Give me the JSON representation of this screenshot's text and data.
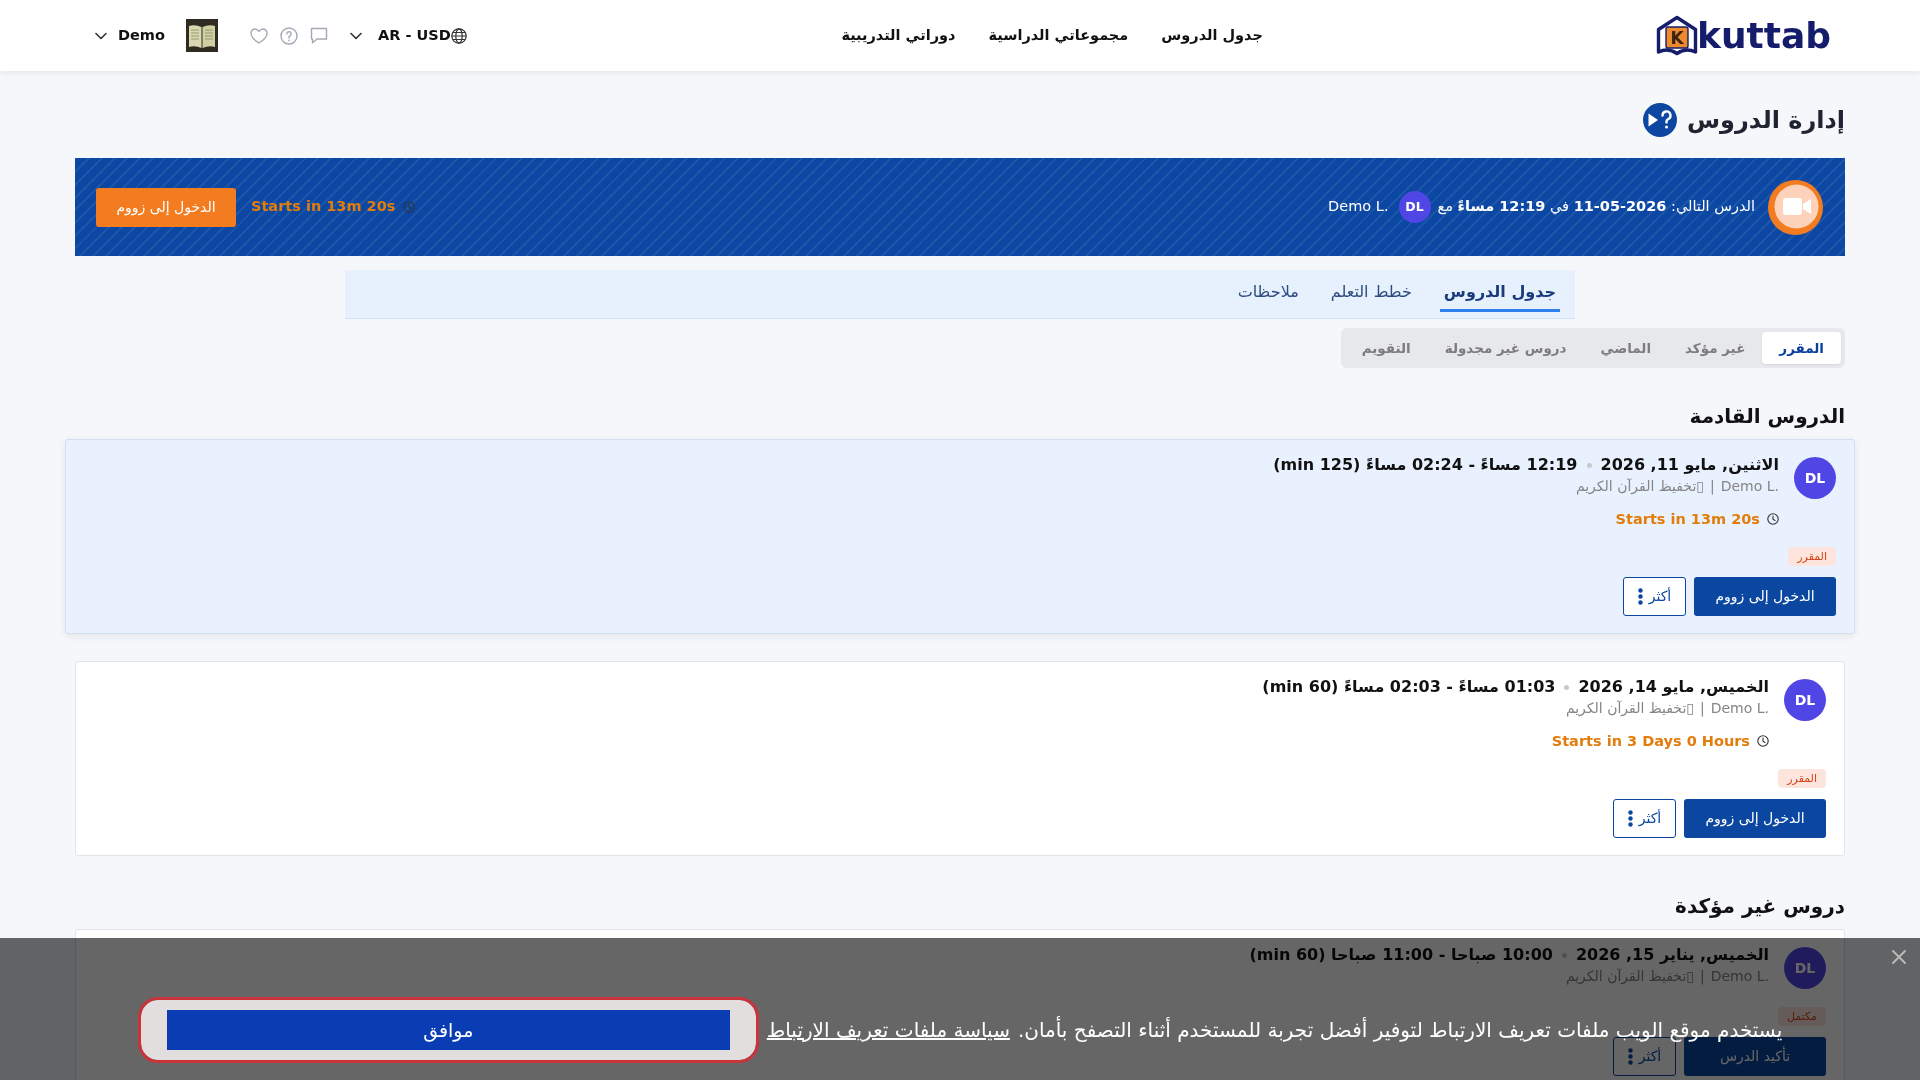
{
  "header": {
    "logo": {
      "letter": "K",
      "name": "kuttab"
    },
    "nav": [
      "جدول الدروس",
      "مجموعاتي الدراسية",
      "دوراتي التدريبية"
    ],
    "locale": "AR - USD",
    "user": "Demo"
  },
  "page_title": "إدارة الدروس",
  "next_lesson": {
    "text": "الدرس التالي: **11-05-2026** في **12:19 مساءً** مع",
    "avatar": "DL",
    "teacher": "Demo L.",
    "countdown": "Starts in 13m 20s",
    "action": "الدخول إلى زووم"
  },
  "tabs": [
    {
      "label": "جدول الدروس",
      "selected": true
    },
    {
      "label": "خطط التعلم",
      "selected": false
    },
    {
      "label": "ملاحظات",
      "selected": false
    }
  ],
  "filters": [
    {
      "label": "المقرر",
      "selected": true
    },
    {
      "label": "غير مؤكد",
      "selected": false
    },
    {
      "label": "الماضي",
      "selected": false
    },
    {
      "label": "دروس غير مجدولة",
      "selected": false
    },
    {
      "label": "التقويم",
      "selected": false
    }
  ],
  "sections": [
    {
      "title": "الدروس القادمة",
      "lessons": [
        {
          "highlighted": true,
          "avatar": "DL",
          "date": "الاثنين, مايو 11, 2026",
          "time": "12:19 مساءً - 02:24 مساءً (125 min)",
          "teacher": "Demo L.",
          "separator": "|",
          "course": "▯تخفيظ القرآن الكريم",
          "countdown": "Starts in 13m 20s",
          "status": "المقرر",
          "action": "الدخول إلى زووم",
          "more": "أكثر"
        },
        {
          "highlighted": false,
          "avatar": "DL",
          "date": "الخميس, مايو 14, 2026",
          "time": "01:03 مساءً - 02:03 مساءً (60 min)",
          "teacher": "Demo L.",
          "separator": "|",
          "course": "▯تخفيظ القرآن الكريم",
          "countdown": "Starts in 3 Days 0 Hours",
          "status": "المقرر",
          "action": "الدخول إلى زووم",
          "more": "أكثر"
        }
      ]
    },
    {
      "title": "دروس غير مؤكدة",
      "lessons": [
        {
          "highlighted": false,
          "avatar": "DL",
          "date": "الخميس, يناير 15, 2026",
          "time": "10:00 صباحا - 11:00 صباحا (60 min)",
          "teacher": "Demo L.",
          "separator": "|",
          "course": "▯تخفيظ القرآن الكريم",
          "status": "مكتمل",
          "action": "تأكيد الدرس",
          "more": "أكثر"
        }
      ]
    }
  ],
  "cookie_notice": {
    "message": "يستخدم موقع الويب ملفات تعريف الارتباط لتوفير أفضل تجربة للمستخدم أثناء التصفح بأمان.",
    "link": "سياسة ملفات تعريف الارتباط",
    "accept": "موافق"
  }
}
